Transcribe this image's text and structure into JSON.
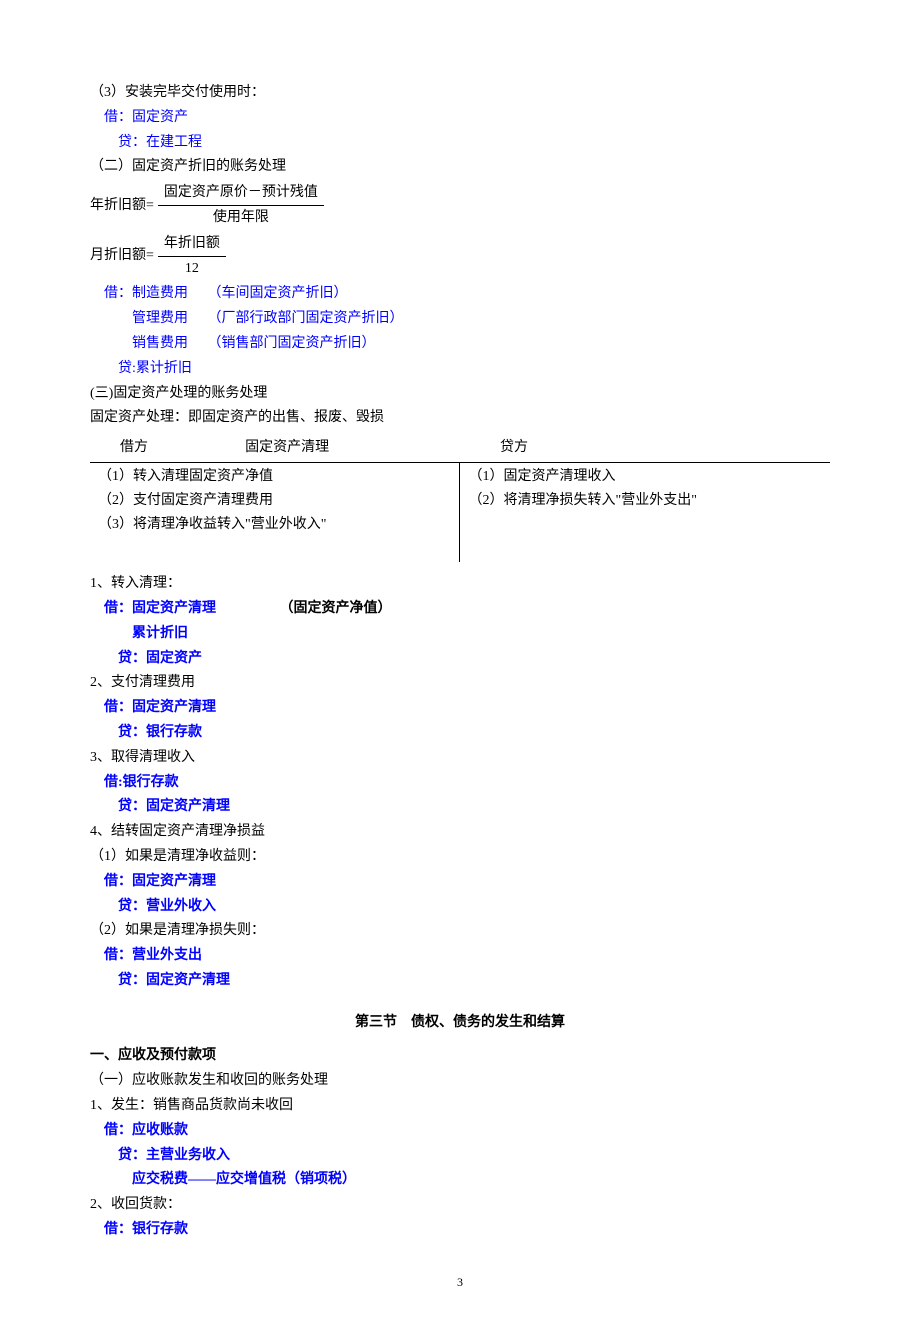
{
  "p1": "（3）安装完毕交付使用时：",
  "e1a": "借：固定资产",
  "e1b": "贷：在建工程",
  "p2": "（二）固定资产折旧的账务处理",
  "frac1_lead": "年折旧额=",
  "frac1_num": "固定资产原价－预计残值",
  "frac1_den": "使用年限",
  "frac2_lead": "月折旧额=",
  "frac2_num": "年折旧额",
  "frac2_den": "12",
  "e2a_label": "借：制造费用",
  "e2a_note": "（车间固定资产折旧）",
  "e2b_label": "管理费用",
  "e2b_note": "（厂部行政部门固定资产折旧）",
  "e2c_label": "销售费用",
  "e2c_note": "（销售部门固定资产折旧）",
  "e2d": "贷:累计折旧",
  "p3": "(三)固定资产处理的账务处理",
  "p4": "固定资产处理：即固定资产的出售、报废、毁损",
  "tbl": {
    "h_debit": "借方",
    "h_account": "固定资产清理",
    "h_credit": "贷方",
    "l1": "（1）转入清理固定资产净值",
    "l2": "（2）支付固定资产清理费用",
    "l3": "（3）将清理净收益转入\"营业外收入\"",
    "r1": "（1）固定资产清理收入",
    "r2": "（2）将清理净损失转入\"营业外支出\""
  },
  "p5": "1、转入清理：",
  "e3a_label": "借：固定资产清理",
  "e3a_note": "（固定资产净值）",
  "e3b": "累计折旧",
  "e3c": "贷：固定资产",
  "p6": "2、支付清理费用",
  "e4a": "借：固定资产清理",
  "e4b": "贷：银行存款",
  "p7": "3、取得清理收入",
  "e5a": "借:银行存款",
  "e5b": "贷：固定资产清理",
  "p8": "4、结转固定资产清理净损益",
  "p8a": "（1）如果是清理净收益则：",
  "e6a": "借：固定资产清理",
  "e6b": "贷：营业外收入",
  "p8b": "（2）如果是清理净损失则：",
  "e7a": "借：营业外支出",
  "e7b": "贷：固定资产清理",
  "section3": "第三节 债权、债务的发生和结算",
  "h1": "一、应收及预付款项",
  "p9": "（一）应收账款发生和收回的账务处理",
  "p10": "1、发生：销售商品货款尚未收回",
  "e8a": "借：应收账款",
  "e8b": "贷：主营业务收入",
  "e8c": "应交税费——应交增值税（销项税）",
  "p11": "2、收回货款：",
  "e9a": "借：银行存款",
  "pageNum": "3"
}
